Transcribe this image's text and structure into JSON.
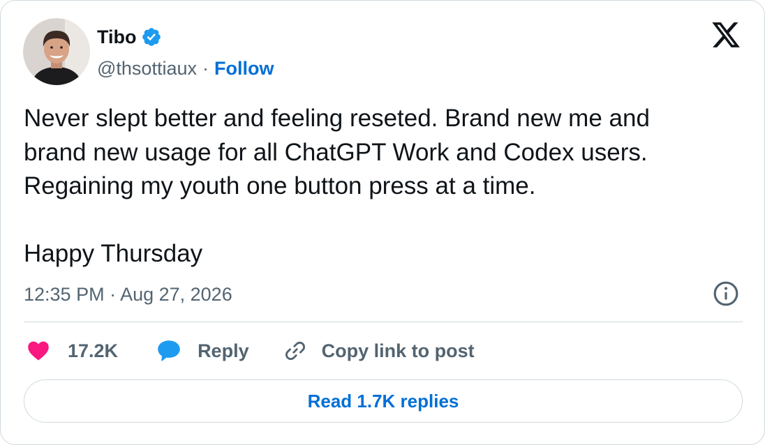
{
  "author": {
    "name": "Tibo",
    "handle": "@thsottiaux",
    "separator": "·",
    "follow_label": "Follow",
    "verified": true,
    "verified_color": "#1d9bf0",
    "avatar_icon": "profile-photo"
  },
  "brand": {
    "logo_icon": "x-logo"
  },
  "tweet": {
    "lines": [
      "Never slept better and feeling reseted. Brand new me and",
      "brand new usage for all ChatGPT Work and Codex users.",
      "Regaining my youth one button press at a time.",
      "",
      "Happy Thursday"
    ]
  },
  "meta": {
    "timestamp": "12:35 PM · Aug 27, 2026",
    "info_icon": "info-icon"
  },
  "actions": {
    "like_count": "17.2K",
    "like_icon": "heart-icon",
    "like_color": "#f91880",
    "reply_label": "Reply",
    "reply_icon": "speech-bubble-icon",
    "reply_color": "#1d9bf0",
    "copy_label": "Copy link to post",
    "copy_icon": "link-icon"
  },
  "footer": {
    "read_replies_label": "Read 1.7K replies"
  },
  "colors": {
    "text": "#0f1419",
    "secondary": "#536471",
    "link": "#006fd6",
    "border": "#cfd9de"
  }
}
